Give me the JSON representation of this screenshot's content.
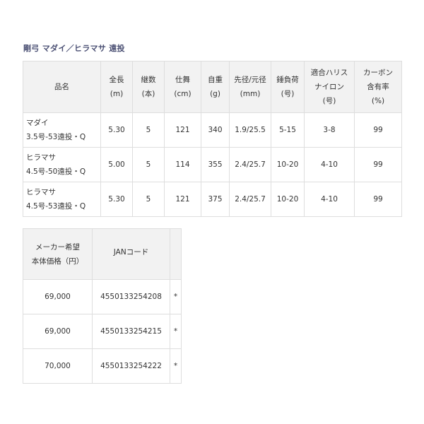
{
  "title": "剛弓 マダイ／ヒラマサ 遠投",
  "spec_table": {
    "headers": [
      [
        "品名"
      ],
      [
        "全長",
        "(m)"
      ],
      [
        "継数",
        "(本)"
      ],
      [
        "仕舞",
        "(cm)"
      ],
      [
        "自重",
        "(g)"
      ],
      [
        "先径/元径",
        "(mm)"
      ],
      [
        "錘負荷",
        "(号)"
      ],
      [
        "適合ハリス",
        "ナイロン",
        "(号)"
      ],
      [
        "カーボン",
        "含有率",
        "(%)"
      ]
    ],
    "rows": [
      {
        "name_1": "マダイ",
        "name_2": "3.5号-53遠投・Q",
        "length": "5.30",
        "sections": "5",
        "closed": "121",
        "weight": "340",
        "diameter": "1.9/25.5",
        "sinker": "5-15",
        "line": "3-8",
        "carbon": "99"
      },
      {
        "name_1": "ヒラマサ",
        "name_2": "4.5号-50遠投・Q",
        "length": "5.00",
        "sections": "5",
        "closed": "114",
        "weight": "355",
        "diameter": "2.4/25.7",
        "sinker": "10-20",
        "line": "4-10",
        "carbon": "99"
      },
      {
        "name_1": "ヒラマサ",
        "name_2": "4.5号-53遠投・Q",
        "length": "5.30",
        "sections": "5",
        "closed": "121",
        "weight": "375",
        "diameter": "2.4/25.7",
        "sinker": "10-20",
        "line": "4-10",
        "carbon": "99"
      }
    ]
  },
  "price_table": {
    "header_price_1": "メーカー希望",
    "header_price_2": "本体価格（円）",
    "header_jan": "JANコード",
    "rows": [
      {
        "price": "69,000",
        "jan": "4550133254208",
        "mark": "*"
      },
      {
        "price": "69,000",
        "jan": "4550133254215",
        "mark": "*"
      },
      {
        "price": "70,000",
        "jan": "4550133254222",
        "mark": "*"
      }
    ]
  }
}
